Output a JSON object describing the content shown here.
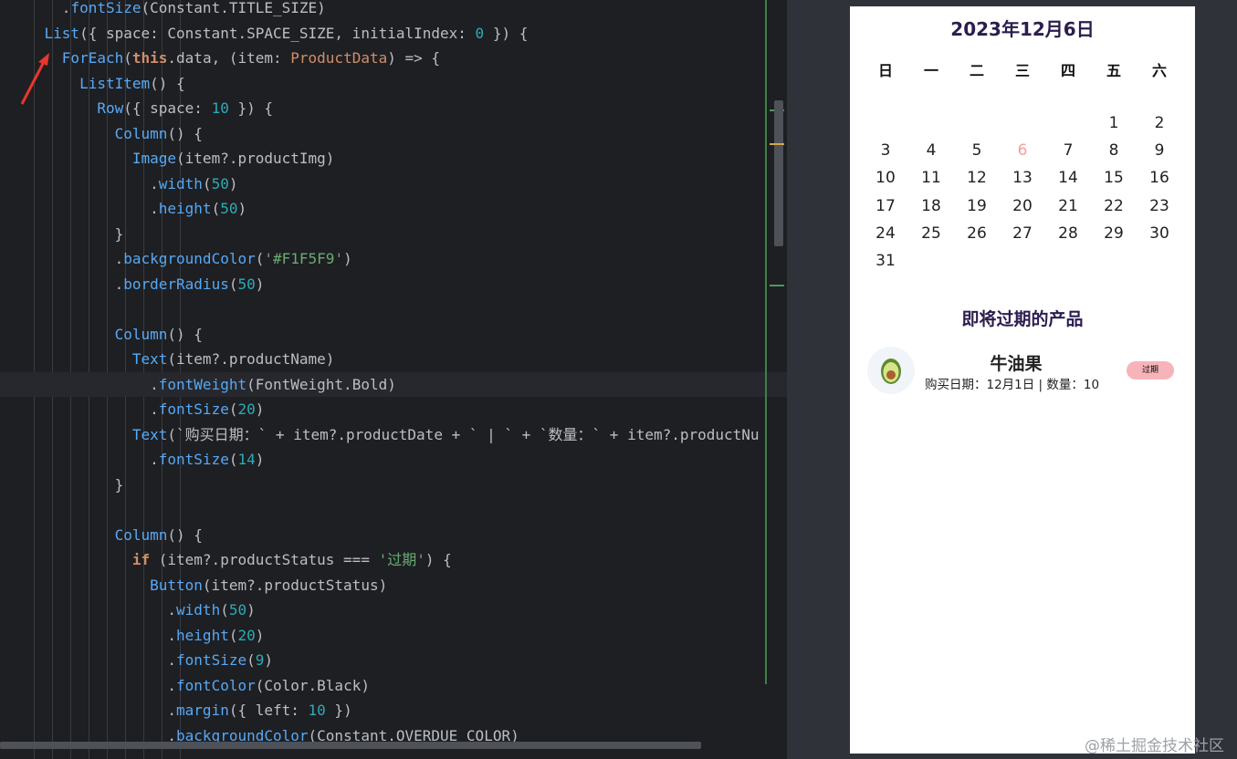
{
  "editor": {
    "lines": [
      "      .fontSize(Constant.TITLE_SIZE)",
      "    List({ space: Constant.SPACE_SIZE, initialIndex: 0 }) {",
      "      ForEach(this.data, (item: ProductData) => {",
      "        ListItem() {",
      "          Row({ space: 10 }) {",
      "            Column() {",
      "              Image(item?.productImg)",
      "                .width(50)",
      "                .height(50)",
      "            }",
      "            .backgroundColor('#F1F5F9')",
      "            .borderRadius(50)",
      "",
      "            Column() {",
      "              Text(item?.productName)",
      "                .fontWeight(FontWeight.Bold)",
      "                .fontSize(20)",
      "              Text(`购买日期：` + item?.productDate + ` | ` + `数量：` + item?.productNu",
      "                .fontSize(14)",
      "            }",
      "",
      "            Column() {",
      "              if (item?.productStatus === '过期') {",
      "                Button(item?.productStatus)",
      "                  .width(50)",
      "                  .height(20)",
      "                  .fontSize(9)",
      "                  .fontColor(Color.Black)",
      "                  .margin({ left: 10 })",
      "                  .backgroundColor(Constant.OVERDUE_COLOR)"
    ]
  },
  "preview": {
    "calendar_title": "2023年12月6日",
    "weekdays": [
      "日",
      "一",
      "二",
      "三",
      "四",
      "五",
      "六"
    ],
    "weeks": [
      [
        "",
        "",
        "",
        "",
        "",
        "1",
        "2"
      ],
      [
        "3",
        "4",
        "5",
        "6",
        "7",
        "8",
        "9"
      ],
      [
        "10",
        "11",
        "12",
        "13",
        "14",
        "15",
        "16"
      ],
      [
        "17",
        "18",
        "19",
        "20",
        "21",
        "22",
        "23"
      ],
      [
        "24",
        "25",
        "26",
        "27",
        "28",
        "29",
        "30"
      ],
      [
        "31",
        "",
        "",
        "",
        "",
        "",
        ""
      ]
    ],
    "today": "6",
    "section_title": "即将过期的产品",
    "product": {
      "name": "牛油果",
      "info": "购买日期：12月1日 | 数量：10",
      "status": "过期",
      "icon": "avocado-icon"
    }
  },
  "watermark": "@稀土掘金技术社区",
  "colors": {
    "editor_bg": "#1e1f22",
    "status_button": "#f7b4b8",
    "today": "#f2a0a0",
    "title": "#2b1d4e"
  }
}
